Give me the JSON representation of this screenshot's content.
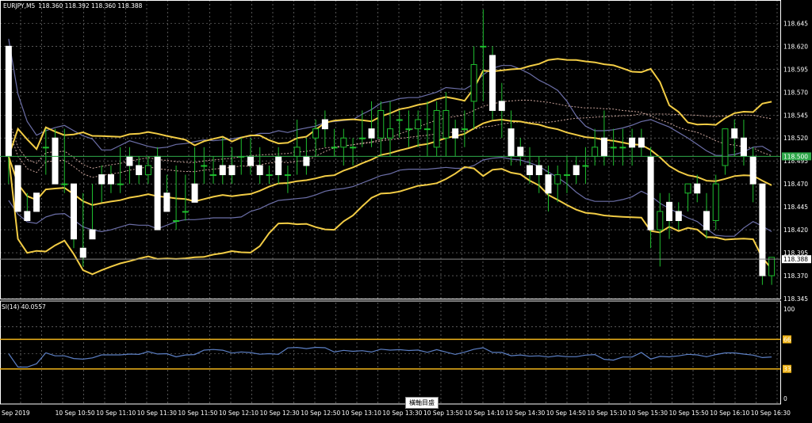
{
  "header": {
    "symbol_tf": "EURJPY,M5",
    "ohlc": "118.360 118.392 118.360 118.388"
  },
  "rsi_header": "SI(14) 40.0557",
  "colors": {
    "background": "#000000",
    "grid": "#ffffff",
    "candle": "#ffffff",
    "wick": "#1fbf2f",
    "bollinger": "#f2cc45",
    "envelope": "#6c6fa8",
    "ichimoku": "#c9a39a",
    "marker_line": "#2ea84a",
    "rsi_line": "#5c7fc4",
    "rsi_level": "#f0b41a"
  },
  "price_axis": {
    "labels": [
      "118.645",
      "118.620",
      "118.595",
      "118.570",
      "118.545",
      "118.520",
      "118.495",
      "118.470",
      "118.445",
      "118.420",
      "118.395",
      "118.370",
      "118.345"
    ]
  },
  "price_tags": [
    {
      "name": "bid-line-tag",
      "label": "118.500",
      "price": 118.5,
      "bg": "#2ea84a",
      "fg": "#ffffff"
    },
    {
      "name": "current-price-tag",
      "label": "118.388",
      "price": 118.388,
      "bg": "#ffffff",
      "fg": "#000000"
    }
  ],
  "rsi_axis": {
    "labels": [
      "100",
      "66",
      "33",
      "0"
    ],
    "values": [
      100,
      66,
      33,
      0
    ]
  },
  "rsi_levels": [
    66,
    33
  ],
  "time_axis": {
    "labels": [
      "Sep 2019",
      "10 Sep 10:50",
      "10 Sep 11:10",
      "10 Sep 11:30",
      "10 Sep 11:50",
      "10 Sep 12:10",
      "10 Sep 12:30",
      "10 Sep 12:50",
      "10 Sep 13:10",
      "10 Sep 13:30",
      "10 Sep 13:50",
      "10 Sep 14:10",
      "10 Sep 14:30",
      "10 Sep 14:50",
      "10 Sep 15:10",
      "10 Sep 15:30",
      "10 Sep 15:50",
      "10 Sep 16:10",
      "10 Sep 16:30"
    ]
  },
  "cursor_tag": "橫軸目盛",
  "chart_data": {
    "type": "candlestick",
    "symbol": "EURJPY",
    "timeframe": "M5",
    "ylim": [
      118.345,
      118.66
    ],
    "candles": [
      [
        118.62,
        118.61,
        118.5,
        118.47
      ],
      [
        118.49,
        118.49,
        118.44,
        118.44
      ],
      [
        118.44,
        118.46,
        118.43,
        118.43
      ],
      [
        118.46,
        118.46,
        118.44,
        118.44
      ],
      [
        118.51,
        118.53,
        118.51,
        118.48
      ],
      [
        118.52,
        118.53,
        118.47,
        118.47
      ],
      [
        118.47,
        118.53,
        118.47,
        118.46
      ],
      [
        118.47,
        118.47,
        118.41,
        118.4
      ],
      [
        118.4,
        118.46,
        118.39,
        118.38
      ],
      [
        118.42,
        118.47,
        118.41,
        118.41
      ],
      [
        118.48,
        118.49,
        118.47,
        118.45
      ],
      [
        118.48,
        118.49,
        118.47,
        118.46
      ],
      [
        118.47,
        118.51,
        118.47,
        118.46
      ],
      [
        118.5,
        118.51,
        118.49,
        118.47
      ],
      [
        118.49,
        118.5,
        118.48,
        118.47
      ],
      [
        118.48,
        118.5,
        118.49,
        118.47
      ],
      [
        118.5,
        118.51,
        118.42,
        118.42
      ],
      [
        118.46,
        118.48,
        118.44,
        118.44
      ],
      [
        118.43,
        118.49,
        118.43,
        118.42
      ],
      [
        118.44,
        118.48,
        118.44,
        118.43
      ],
      [
        118.47,
        118.51,
        118.45,
        118.45
      ],
      [
        118.49,
        118.51,
        118.49,
        118.47
      ],
      [
        118.48,
        118.5,
        118.48,
        118.47
      ],
      [
        118.49,
        118.52,
        118.48,
        118.47
      ],
      [
        118.49,
        118.51,
        118.48,
        118.47
      ],
      [
        118.5,
        118.52,
        118.5,
        118.48
      ],
      [
        118.5,
        118.52,
        118.49,
        118.48
      ],
      [
        118.49,
        118.51,
        118.48,
        118.47
      ],
      [
        118.48,
        118.49,
        118.48,
        118.47
      ],
      [
        118.5,
        118.51,
        118.48,
        118.47
      ],
      [
        118.48,
        118.49,
        118.48,
        118.46
      ],
      [
        118.5,
        118.54,
        118.51,
        118.48
      ],
      [
        118.5,
        118.52,
        118.49,
        118.48
      ],
      [
        118.52,
        118.54,
        118.53,
        118.5
      ],
      [
        118.54,
        118.55,
        118.53,
        118.51
      ],
      [
        118.51,
        118.53,
        118.51,
        118.5
      ],
      [
        118.51,
        118.53,
        118.52,
        118.49
      ],
      [
        118.51,
        118.52,
        118.51,
        118.49
      ],
      [
        118.52,
        118.55,
        118.52,
        118.51
      ],
      [
        118.53,
        118.56,
        118.52,
        118.51
      ],
      [
        118.52,
        118.56,
        118.55,
        118.5
      ],
      [
        118.52,
        118.56,
        118.53,
        118.5
      ],
      [
        118.54,
        118.55,
        118.54,
        118.52
      ],
      [
        118.53,
        118.55,
        118.53,
        118.51
      ],
      [
        118.53,
        118.55,
        118.54,
        118.51
      ],
      [
        118.53,
        118.56,
        118.53,
        118.5
      ],
      [
        118.51,
        118.56,
        118.55,
        118.5
      ],
      [
        118.52,
        118.57,
        118.55,
        118.5
      ],
      [
        118.53,
        118.54,
        118.52,
        118.5
      ],
      [
        118.53,
        118.55,
        118.53,
        118.51
      ],
      [
        118.56,
        118.62,
        118.6,
        118.53
      ],
      [
        118.62,
        118.66,
        118.62,
        118.56
      ],
      [
        118.61,
        118.62,
        118.55,
        118.54
      ],
      [
        118.56,
        118.58,
        118.55,
        118.52
      ],
      [
        118.53,
        118.55,
        118.5,
        118.49
      ],
      [
        118.51,
        118.52,
        118.5,
        118.49
      ],
      [
        118.49,
        118.51,
        118.48,
        118.47
      ],
      [
        118.49,
        118.5,
        118.48,
        118.46
      ],
      [
        118.48,
        118.49,
        118.46,
        118.44
      ],
      [
        118.47,
        118.49,
        118.48,
        118.45
      ],
      [
        118.48,
        118.5,
        118.48,
        118.46
      ],
      [
        118.49,
        118.5,
        118.48,
        118.47
      ],
      [
        118.49,
        118.51,
        118.49,
        118.47
      ],
      [
        118.5,
        118.53,
        118.51,
        118.49
      ],
      [
        118.52,
        118.55,
        118.5,
        118.49
      ],
      [
        118.51,
        118.53,
        118.51,
        118.49
      ],
      [
        118.51,
        118.53,
        118.51,
        118.49
      ],
      [
        118.52,
        118.53,
        118.51,
        118.49
      ],
      [
        118.52,
        118.53,
        118.51,
        118.5
      ],
      [
        118.5,
        118.51,
        118.42,
        118.4
      ],
      [
        118.42,
        118.46,
        118.44,
        118.38
      ],
      [
        118.45,
        118.46,
        118.43,
        118.41
      ],
      [
        118.44,
        118.45,
        118.43,
        118.42
      ],
      [
        118.46,
        118.47,
        118.47,
        118.44
      ],
      [
        118.47,
        118.48,
        118.46,
        118.45
      ],
      [
        118.44,
        118.46,
        118.42,
        118.41
      ],
      [
        118.43,
        118.48,
        118.47,
        118.42
      ],
      [
        118.49,
        118.53,
        118.53,
        118.48
      ],
      [
        118.53,
        118.54,
        118.52,
        118.5
      ],
      [
        118.52,
        118.54,
        118.5,
        118.49
      ],
      [
        118.5,
        118.51,
        118.47,
        118.45
      ],
      [
        118.47,
        118.47,
        118.37,
        118.36
      ],
      [
        118.37,
        118.39,
        118.39,
        118.36
      ]
    ],
    "candle_fields": [
      "open",
      "high",
      "close",
      "low"
    ]
  }
}
